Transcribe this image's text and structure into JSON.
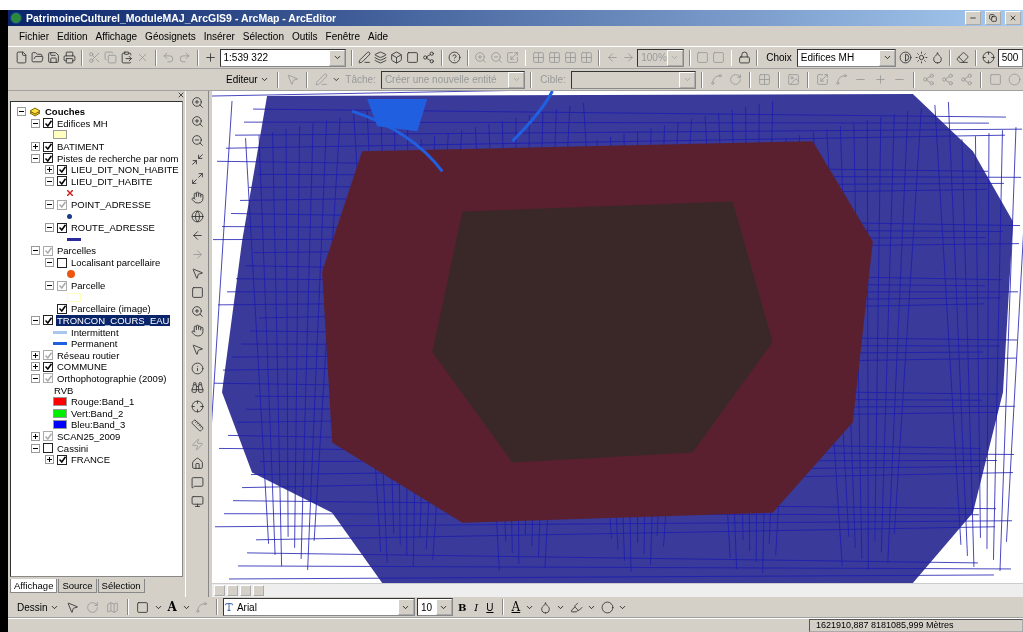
{
  "window": {
    "title": "PatrimoineCulturel_ModuleMAJ_ArcGIS9 - ArcMap - ArcEditor"
  },
  "menu": [
    "Fichier",
    "Edition",
    "Affichage",
    "Géosignets",
    "Insérer",
    "Sélection",
    "Outils",
    "Fenêtre",
    "Aide"
  ],
  "standard_toolbar": {
    "scale": "1:539 322"
  },
  "layout_toolbar": {
    "zoom": "100%"
  },
  "effects_toolbar": {
    "label": "Choix",
    "layer": "Edifices MH",
    "value": "500"
  },
  "editor_toolbar": {
    "menu": "Editeur",
    "task_label": "Tâche:",
    "task": "Créer une nouvelle entité",
    "target_label": "Cible:"
  },
  "toc": {
    "root": {
      "label": "Couches",
      "expanded": true,
      "children": [
        {
          "label": "Edifices MH",
          "checked": true,
          "dimmed": false,
          "expanded": true,
          "legend": [
            {
              "kind": "swatch",
              "color": "#ffffc0"
            }
          ]
        },
        {
          "label": "BATIMENT",
          "checked": true,
          "dimmed": false,
          "expanded": false
        },
        {
          "label": "Pistes de recherche par nom",
          "checked": true,
          "dimmed": false,
          "expanded": true,
          "children": [
            {
              "label": "LIEU_DIT_NON_HABITE",
              "checked": true,
              "dimmed": false,
              "expanded": false
            },
            {
              "label": "LIEU_DIT_HABITE",
              "checked": true,
              "dimmed": false,
              "expanded": true,
              "legend": [
                {
                  "kind": "cross",
                  "color": "#cc2222"
                }
              ]
            },
            {
              "label": "POINT_ADRESSE",
              "checked": true,
              "dimmed": true,
              "expanded": true,
              "legend": [
                {
                  "kind": "dot",
                  "color": "#1a3a8a"
                }
              ]
            },
            {
              "label": "ROUTE_ADRESSE",
              "checked": true,
              "dimmed": false,
              "expanded": true,
              "legend": [
                {
                  "kind": "line",
                  "color": "#2a2a9a"
                }
              ]
            }
          ]
        },
        {
          "label": "Parcelles",
          "checked": true,
          "dimmed": true,
          "expanded": true,
          "children": [
            {
              "label": "Localisant parcellaire",
              "checked": false,
              "dimmed": false,
              "expanded": true,
              "legend": [
                {
                  "kind": "circle",
                  "color": "#ee5511"
                }
              ]
            },
            {
              "label": "Parcelle",
              "checked": true,
              "dimmed": true,
              "expanded": true,
              "legend": [
                {
                  "kind": "outline",
                  "color": "#ffffc0"
                }
              ]
            },
            {
              "label": "Parcellaire (image)",
              "checked": true,
              "dimmed": false
            }
          ]
        },
        {
          "label": "TRONCON_COURS_EAU",
          "checked": true,
          "dimmed": false,
          "selected": true,
          "expanded": true,
          "legend": [
            {
              "kind": "line",
              "color": "#a8c8f0",
              "label": "Intermittent"
            },
            {
              "kind": "line",
              "color": "#2060e0",
              "label": "Permanent"
            }
          ]
        },
        {
          "label": "Réseau routier",
          "checked": true,
          "dimmed": true,
          "expanded": false
        },
        {
          "label": "COMMUNE",
          "checked": true,
          "dimmed": false,
          "expanded": false
        },
        {
          "label": "Orthophotographie (2009)",
          "checked": true,
          "dimmed": true,
          "expanded": true,
          "legend": [
            {
              "kind": "text",
              "label": "RVB"
            },
            {
              "kind": "swatch",
              "color": "#ff0000",
              "label": "Rouge:Band_1"
            },
            {
              "kind": "swatch",
              "color": "#00ee00",
              "label": "Vert:Band_2"
            },
            {
              "kind": "swatch",
              "color": "#0000ff",
              "label": "Bleu:Band_3"
            }
          ]
        },
        {
          "label": "SCAN25_2009",
          "checked": true,
          "dimmed": true,
          "expanded": false
        },
        {
          "label": "Cassini",
          "checked": false,
          "dimmed": false,
          "expanded": true,
          "children": [
            {
              "label": "FRANCE",
              "checked": true,
              "dimmed": false,
              "expanded": false
            }
          ]
        }
      ]
    }
  },
  "toc_tabs": [
    {
      "label": "Affichage",
      "selected": true
    },
    {
      "label": "Source",
      "selected": false
    },
    {
      "label": "Sélection",
      "selected": false
    }
  ],
  "drawing_toolbar": {
    "menu": "Dessin",
    "font": "Arial",
    "size": "10",
    "bold": "B",
    "italic": "I",
    "underline": "U",
    "font_color": "A",
    "text_tool": "A"
  },
  "status_bar": {
    "coordinates": "1621910,887  8181085,999 Mètres"
  }
}
